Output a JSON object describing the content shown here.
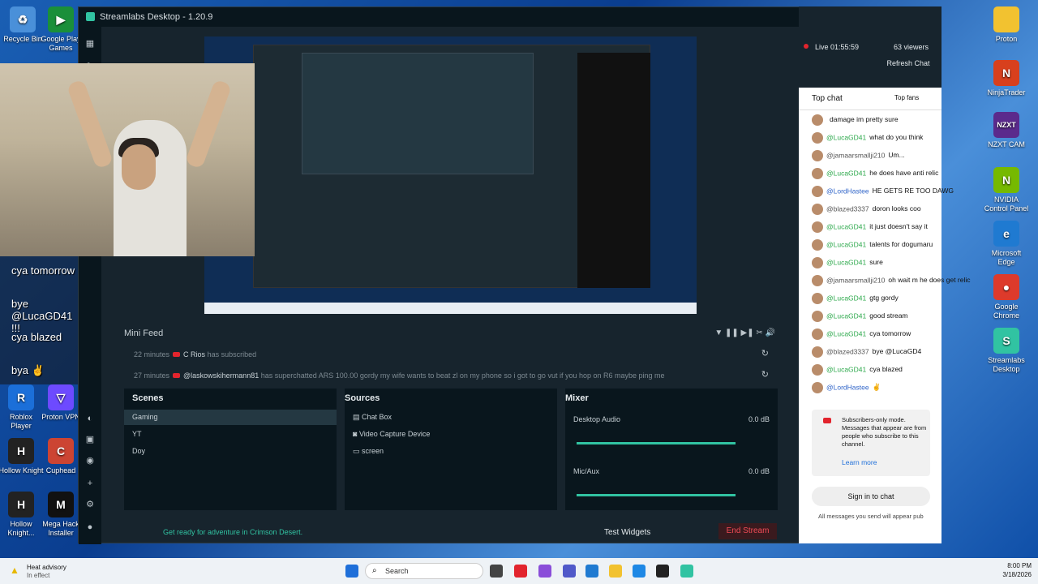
{
  "window": {
    "title": "Streamlabs Desktop - 1.20.9"
  },
  "desktop_icons": [
    {
      "label": "Recycle Bin",
      "color": "#4a90d9",
      "glyph": "♻"
    },
    {
      "label": "Google Play Games",
      "color": "#1a8f3a",
      "glyph": "▶"
    },
    {
      "label": "Roblox Player",
      "color": "#1b6fd9",
      "glyph": "R"
    },
    {
      "label": "Proton VPN",
      "color": "#6d4aff",
      "glyph": "▽"
    },
    {
      "label": "Hollow Knight",
      "color": "#222",
      "glyph": "H"
    },
    {
      "label": "Cuphead",
      "color": "#c43",
      "glyph": "C"
    },
    {
      "label": "Hollow Knight...",
      "color": "#222",
      "glyph": "H"
    },
    {
      "label": "Mega Hack Installer",
      "color": "#111",
      "glyph": "M"
    },
    {
      "label": "Proton",
      "color": "#f2c230",
      "glyph": "📁"
    },
    {
      "label": "NinjaTrader",
      "color": "#d8401d",
      "glyph": "N"
    },
    {
      "label": "NZXT CAM",
      "color": "#5b2a8c",
      "glyph": "NZXT"
    },
    {
      "label": "NVIDIA Control Panel",
      "color": "#76b900",
      "glyph": "N"
    },
    {
      "label": "Microsoft Edge",
      "color": "#1f7ad1",
      "glyph": "e"
    },
    {
      "label": "Google Chrome",
      "color": "#dd3a2b",
      "glyph": "●"
    },
    {
      "label": "Streamlabs Desktop",
      "color": "#31c3a2",
      "glyph": "S"
    }
  ],
  "overlay_chat": [
    "cya tomorrow",
    "bye @LucaGD41 !!!",
    "cya blazed",
    "bya ✌"
  ],
  "mini_feed": {
    "title": "Mini Feed",
    "rows": [
      {
        "time": "22 minutes",
        "name": "C Rios",
        "text": "has subscribed"
      },
      {
        "time": "27 minutes",
        "name": "@laskowskihermann81",
        "text": "has superchatted  ARS 100.00  gordy my wife wants to beat zl on my phone so i got to go vut if you hop on R6 maybe ping me"
      }
    ]
  },
  "scenes": {
    "title": "Scenes",
    "items": [
      "Gaming",
      "YT",
      "Doy"
    ]
  },
  "sources": {
    "title": "Sources",
    "items": [
      "Chat Box",
      "Video Capture Device",
      "screen"
    ]
  },
  "mixer": {
    "title": "Mixer",
    "channels": [
      {
        "name": "Desktop Audio",
        "level": "0.0 dB",
        "fill": 0.96
      },
      {
        "name": "Mic/Aux",
        "level": "0.0 dB",
        "fill": 0.96
      }
    ]
  },
  "bottom": {
    "promo": "Get ready for adventure in Crimson Desert.",
    "test_widgets": "Test Widgets",
    "end_stream": "End Stream"
  },
  "chat": {
    "live": "Live 01:55:59",
    "viewers": "63 viewers",
    "refresh": "Refresh Chat",
    "top_chat": "Top chat",
    "top_fans": "Top fans",
    "messages": [
      {
        "name": "",
        "text": "damage im pretty sure",
        "color": "gray"
      },
      {
        "name": "@LucaGD41",
        "text": "what do you think",
        "color": "green"
      },
      {
        "name": "@jamaarsmallji210",
        "text": "Um...",
        "color": "gray"
      },
      {
        "name": "@LucaGD41",
        "text": "he does have anti relic",
        "color": "green"
      },
      {
        "name": "@LordHastee",
        "text": "HE GETS RE TOO DAWG",
        "color": "blue"
      },
      {
        "name": "@blazed3337",
        "text": "doron looks coo",
        "color": "gray"
      },
      {
        "name": "@LucaGD41",
        "text": "it just doesn't say it",
        "color": "green"
      },
      {
        "name": "@LucaGD41",
        "text": "talents for dogumaru",
        "color": "green"
      },
      {
        "name": "@LucaGD41",
        "text": "sure",
        "color": "green"
      },
      {
        "name": "@jamaarsmallji210",
        "text": "oh wait m he does get relic",
        "color": "gray"
      },
      {
        "name": "@LucaGD41",
        "text": "gtg gordy",
        "color": "green"
      },
      {
        "name": "@LucaGD41",
        "text": "good stream",
        "color": "green"
      },
      {
        "name": "@LucaGD41",
        "text": "cya tomorrow",
        "color": "green"
      },
      {
        "name": "@blazed3337",
        "text": "bye @LucaGD4",
        "color": "gray"
      },
      {
        "name": "@LucaGD41",
        "text": "cya blazed",
        "color": "green"
      },
      {
        "name": "@LordHastee",
        "text": "✌",
        "color": "blue"
      }
    ],
    "notice": "Subscribers-only mode. Messages that appear are from people who subscribe to this channel.",
    "learn_more": "Learn more",
    "sign_in": "Sign in to chat",
    "footer": "All messages you send will appear pub"
  },
  "taskbar": {
    "weather_title": "Heat advisory",
    "weather_sub": "In effect",
    "search": "Search",
    "time": "8:00 PM",
    "date": "3/18/2026"
  }
}
